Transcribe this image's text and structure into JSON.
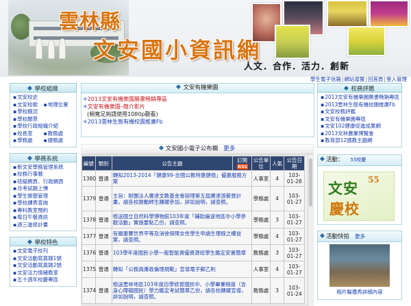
{
  "banner": {
    "title_line1": "雲林縣",
    "title_line2": "文安國小資訊網",
    "motto": "人文．合作．活力．創新"
  },
  "toplinks": [
    {
      "label": "學生電子信箱"
    },
    {
      "label": "網站導覽"
    },
    {
      "label": "回首頁"
    },
    {
      "label": "登入管理"
    }
  ],
  "left": {
    "school_org": {
      "title": "學校組織",
      "items": [
        {
          "label": "文安校史"
        },
        {
          "label": "文安校歌"
        },
        {
          "label": "地理位置"
        },
        {
          "label": "學校概況"
        },
        {
          "label": "學校願景"
        },
        {
          "label": "學校行政組織介紹"
        },
        {
          "label": "校長室"
        },
        {
          "label": "教務處"
        },
        {
          "label": "學務處"
        },
        {
          "label": "總務處"
        }
      ]
    },
    "school_sys": {
      "title": "學務系統",
      "items": [
        {
          "label": "新文安學務管理系統"
        },
        {
          "label": "校務行事曆"
        },
        {
          "label": "班級網頁、行政網頁"
        },
        {
          "label": "月考試題上傳"
        },
        {
          "label": "學生獎懲管理"
        },
        {
          "label": "學校課表查詢"
        },
        {
          "label": "專科教室預約"
        },
        {
          "label": "每日午餐資訊"
        },
        {
          "label": "週三進修計畫"
        }
      ]
    },
    "features": {
      "title": "學校特色",
      "items": [
        {
          "label": "文安電子校刊"
        },
        {
          "label": "文安活動寫真錄1號"
        },
        {
          "label": "文安活動寫真錄2號"
        },
        {
          "label": "文安活力情緒教室"
        },
        {
          "label": "五十週年校慶專區"
        }
      ]
    }
  },
  "center": {
    "ann_title": "文安有機樂園",
    "ann_items": [
      {
        "text": "2013文安有機樂園勝書畅銷專區",
        "color": "red",
        "star": true
      },
      {
        "text": "文安有機樂園–簡介影片",
        "color": "red",
        "star": true
      },
      {
        "text": "(頻寬足夠請使用1080p觀看)",
        "color": "dark",
        "star": false
      },
      {
        "text": "2013雲林生態有機校園推廣Fb",
        "color": "blue",
        "star": true
      }
    ],
    "bulletin": {
      "title": "文安國小電子公布欄",
      "more": "更多",
      "columns": [
        "編號",
        "類別",
        "公告主題",
        "訂閱",
        "公告單位",
        "人氣",
        "公告日期"
      ],
      "rss_label": "RSS",
      "rows": [
        {
          "id": "1380",
          "type": "普通",
          "subject": "轉知2013-2014「健康99-全國公教特惠健檢」優惠服務方案",
          "unit": "人事室",
          "views": "4",
          "date": "103-01-28"
        },
        {
          "id": "1379",
          "type": "普通",
          "subject": "主旨：財團法人廣達文教基金會辦理第五屆廣達游藝營計畫，請各校鼓勵師生踴躍參加，詳如說明，請查照。",
          "unit": "學務處",
          "views": "4",
          "date": "103-01-27"
        },
        {
          "id": "1378",
          "type": "普通",
          "subject": "檢送國立自然科學博物館103年度「輔助偏遠地區中小學參觀活動」實施要點乙份，請查照。",
          "unit": "學務處",
          "views": "3",
          "date": "103-01-27"
        },
        {
          "id": "1377",
          "type": "普通",
          "subject": "有關惠賽世界平等及消徐保障女性學生申請生理假之權益案，請查照。",
          "unit": "學務處",
          "views": "4",
          "date": "103-01-27"
        },
        {
          "id": "1376",
          "type": "普通",
          "subject": "103學年度國民小學一般智能資優資源班學生鑑定安置簡章",
          "unit": "教務處",
          "views": "3",
          "date": "103-01-27"
        },
        {
          "id": "1375",
          "type": "普通",
          "subject": "轉知「公務員廉政倫理規範」宣導電子郵乙則",
          "unit": "人事室",
          "views": "4",
          "date": "103-01-27"
        },
        {
          "id": "1374",
          "type": "普通",
          "subject": "檢送雲林地區103年度自學修習國民中、小學畢業程度（含身心障礙國民）學力鑑定考試簡章乙份，請各校踴躍宣導，詳如說明，請查照。",
          "unit": "教務處",
          "views": "3",
          "date": "103-01-24"
        }
      ]
    }
  },
  "right": {
    "news": {
      "title": "校務評鑑",
      "items": [
        {
          "label": "2013文安有機樂園勝書畅銷專區"
        },
        {
          "label": "2013雲林生態有機校園推廣Fb"
        },
        {
          "label": "文安校務評鑑"
        },
        {
          "label": "文安有機樂園專區"
        },
        {
          "label": "文安102健康促進成果網"
        },
        {
          "label": "2013文林農業博覽會"
        },
        {
          "label": "教育部12國教主題網"
        }
      ]
    },
    "activity": {
      "title": "活動：",
      "count": "55校慶",
      "anniv_top": "文安",
      "anniv_num": "55",
      "anniv_bot": "慶校"
    },
    "snapshot": {
      "title": "活動快拍",
      "more": "更多",
      "caption": "相片輪播秀詳細內容"
    }
  }
}
